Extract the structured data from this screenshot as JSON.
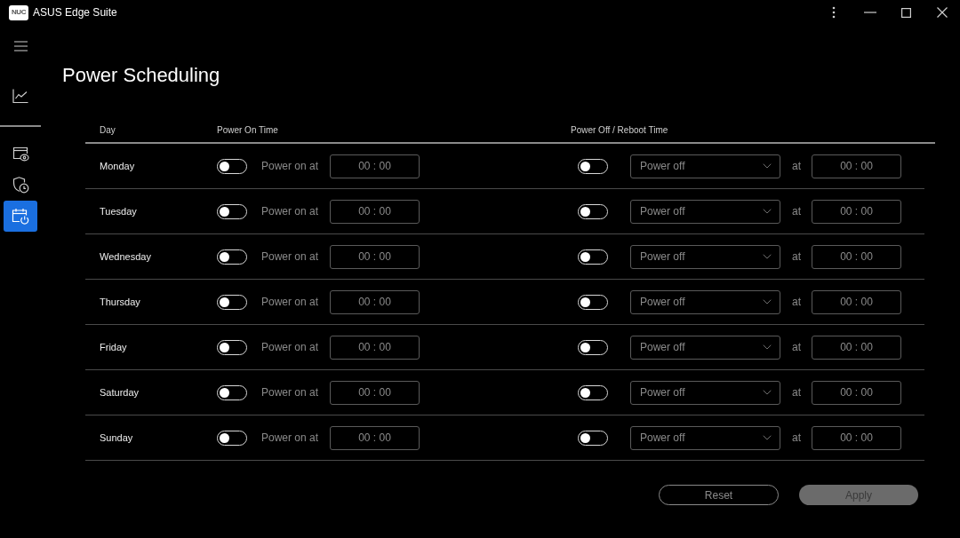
{
  "window": {
    "logo_text": "NUC",
    "title": "ASUS Edge Suite"
  },
  "sidebar": {
    "items": [
      {
        "selected": false
      },
      {
        "selected": false
      },
      {
        "selected": false
      },
      {
        "selected": true
      }
    ]
  },
  "page": {
    "title": "Power Scheduling"
  },
  "table": {
    "columns": [
      "Day",
      "Power On Time",
      "Power Off / Reboot Time"
    ],
    "rows": [
      {
        "day": "Monday",
        "power_on": {
          "on": false,
          "label": "Power on at",
          "time": "00 : 00"
        },
        "power_off": {
          "on": false,
          "action": "Power off",
          "at": "at",
          "time": "00 : 00"
        }
      },
      {
        "day": "Tuesday",
        "power_on": {
          "on": false,
          "label": "Power on at",
          "time": "00 : 00"
        },
        "power_off": {
          "on": false,
          "action": "Power off",
          "at": "at",
          "time": "00 : 00"
        }
      },
      {
        "day": "Wednesday",
        "power_on": {
          "on": false,
          "label": "Power on at",
          "time": "00 : 00"
        },
        "power_off": {
          "on": false,
          "action": "Power off",
          "at": "at",
          "time": "00 : 00"
        }
      },
      {
        "day": "Thursday",
        "power_on": {
          "on": false,
          "label": "Power on at",
          "time": "00 : 00"
        },
        "power_off": {
          "on": false,
          "action": "Power off",
          "at": "at",
          "time": "00 : 00"
        }
      },
      {
        "day": "Friday",
        "power_on": {
          "on": false,
          "label": "Power on at",
          "time": "00 : 00"
        },
        "power_off": {
          "on": false,
          "action": "Power off",
          "at": "at",
          "time": "00 : 00"
        }
      },
      {
        "day": "Saturday",
        "power_on": {
          "on": false,
          "label": "Power on at",
          "time": "00 : 00"
        },
        "power_off": {
          "on": false,
          "action": "Power off",
          "at": "at",
          "time": "00 : 00"
        }
      },
      {
        "day": "Sunday",
        "power_on": {
          "on": false,
          "label": "Power on at",
          "time": "00 : 00"
        },
        "power_off": {
          "on": false,
          "action": "Power off",
          "at": "at",
          "time": "00 : 00"
        }
      }
    ]
  },
  "buttons": [
    {
      "kind": "outline",
      "label": "Reset",
      "disabled": false
    },
    {
      "kind": "primary",
      "label": "Apply",
      "disabled": true
    }
  ]
}
